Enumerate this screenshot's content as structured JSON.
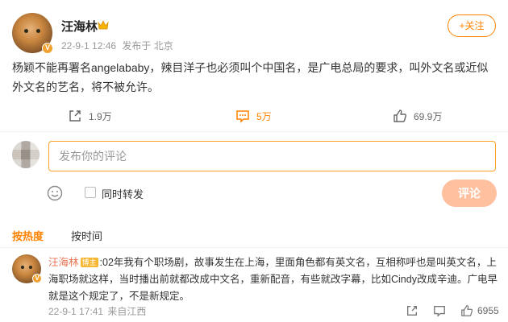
{
  "post": {
    "author": "汪海林",
    "date": "22-9-1 12:46",
    "source": "发布于 北京",
    "follow_label": "+关注",
    "text": "杨颖不能再署名angelababy，辣目洋子也必须叫个中国名，是广电总局的要求，叫外文名或近似外文名的艺名，将不被允许。",
    "actions": {
      "shares": "1.9万",
      "comments": "5万",
      "likes": "69.9万"
    }
  },
  "composer": {
    "placeholder": "发布你的评论",
    "repost_label": "同时转发",
    "submit_label": "评论"
  },
  "sort_tabs": {
    "hot": "按热度",
    "time": "按时间"
  },
  "comment": {
    "author": "汪海林",
    "tag": "博主",
    "text": ":02年我有个职场剧，故事发生在上海，里面角色都有英文名，互相称呼也是叫英文名，上海职场就这样，当时播出前就都改成中文名，重新配音，有些就改字幕，比如Cindy改成辛迪。广电早就是这个规定了，不是新规定。",
    "date": "22-9-1 17:41",
    "source": "来自江西",
    "likes": "6955"
  },
  "colors": {
    "accent": "#ff8200",
    "name": "#eb7350",
    "submit_disabled": "#ffc09f"
  },
  "icons": {
    "verified_badge": "V",
    "crown": "crown-icon",
    "share": "share-icon",
    "comment": "comment-icon",
    "like": "thumb-up-icon",
    "emoji": "emoji-icon"
  }
}
